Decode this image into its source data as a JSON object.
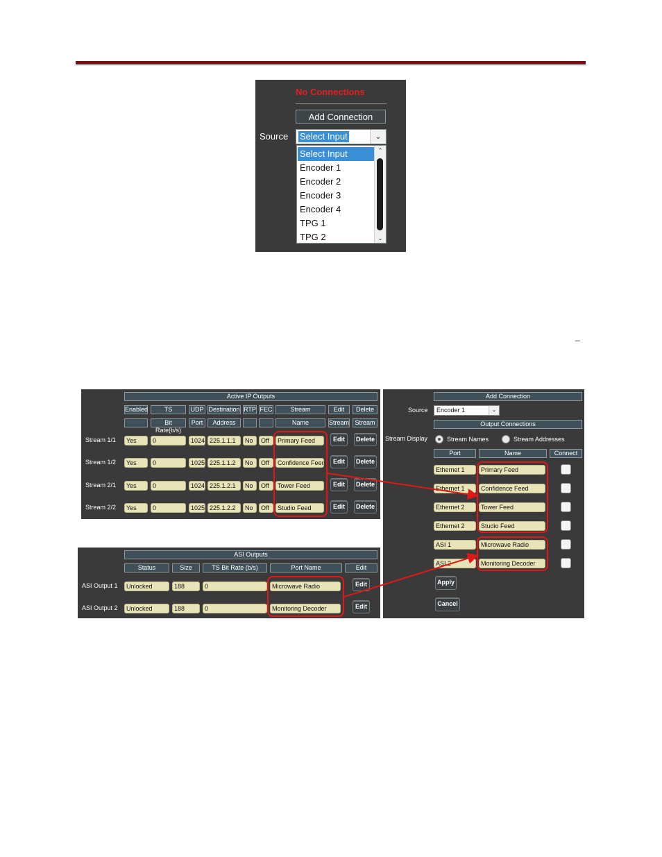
{
  "dropdown": {
    "status": "No Connections",
    "add_button": "Add Connection",
    "source_label": "Source",
    "selected": "Select Input",
    "options": [
      "Select Input",
      "Encoder 1",
      "Encoder 2",
      "Encoder 3",
      "Encoder 4",
      "TPG 1",
      "TPG 2"
    ]
  },
  "stray_mark": "_",
  "ip_outputs": {
    "title": "Active IP Outputs",
    "headers_row1": [
      "Enabled",
      "TS",
      "UDP",
      "Destination",
      "RTP",
      "FEC",
      "Stream",
      "Edit",
      "Delete"
    ],
    "headers_row2": [
      "",
      "Bit Rate(b/s)",
      "Port",
      "Address",
      "",
      "",
      "Name",
      "Stream",
      "Stream"
    ],
    "rows": [
      {
        "label": "Stream 1/1",
        "enabled": "Yes",
        "bitrate": "0",
        "port": "1024",
        "address": "225.1.1.1",
        "rtp": "No",
        "fec": "Off",
        "name": "Primary Feed"
      },
      {
        "label": "Stream 1/2",
        "enabled": "Yes",
        "bitrate": "0",
        "port": "1025",
        "address": "225.1.1.2",
        "rtp": "No",
        "fec": "Off",
        "name": "Confidence Feed"
      },
      {
        "label": "Stream 2/1",
        "enabled": "Yes",
        "bitrate": "0",
        "port": "1024",
        "address": "225.1.2.1",
        "rtp": "No",
        "fec": "Off",
        "name": "Tower Feed"
      },
      {
        "label": "Stream 2/2",
        "enabled": "Yes",
        "bitrate": "0",
        "port": "1025",
        "address": "225.1.2.2",
        "rtp": "No",
        "fec": "Off",
        "name": "Studio Feed"
      }
    ],
    "edit_label": "Edit",
    "delete_label": "Delete"
  },
  "asi_outputs": {
    "title": "ASI Outputs",
    "headers": [
      "Status",
      "Size",
      "TS Bit Rate (b/s)",
      "Port Name",
      "Edit"
    ],
    "rows": [
      {
        "label": "ASI Output 1",
        "status": "Unlocked",
        "size": "188",
        "bitrate": "0",
        "name": "Microwave Radio"
      },
      {
        "label": "ASI Output 2",
        "status": "Unlocked",
        "size": "188",
        "bitrate": "0",
        "name": "Monitoring Decoder"
      }
    ],
    "edit_label": "Edit"
  },
  "add_connection": {
    "title": "Add Connection",
    "source_label": "Source",
    "source_value": "Encoder 1",
    "output_connections_title": "Output Connections",
    "stream_display_label": "Stream Display",
    "radio_names": "Stream Names",
    "radio_addresses": "Stream Addresses",
    "col_port": "Port",
    "col_name": "Name",
    "col_connect": "Connect",
    "rows": [
      {
        "port": "Ethernet 1",
        "name": "Primary Feed"
      },
      {
        "port": "Ethernet 1",
        "name": "Confidence Feed"
      },
      {
        "port": "Ethernet 2",
        "name": "Tower Feed"
      },
      {
        "port": "Ethernet 2",
        "name": "Studio Feed"
      },
      {
        "port": "ASI 1",
        "name": "Microwave Radio"
      },
      {
        "port": "ASI 2",
        "name": "Monitoring Decoder"
      }
    ],
    "apply_label": "Apply",
    "cancel_label": "Cancel"
  },
  "colors": {
    "accent_rule": "#7a0c10",
    "highlight": "#e01818",
    "field_bg": "#e8e4b8",
    "panel_bg": "#3a3a3a"
  }
}
